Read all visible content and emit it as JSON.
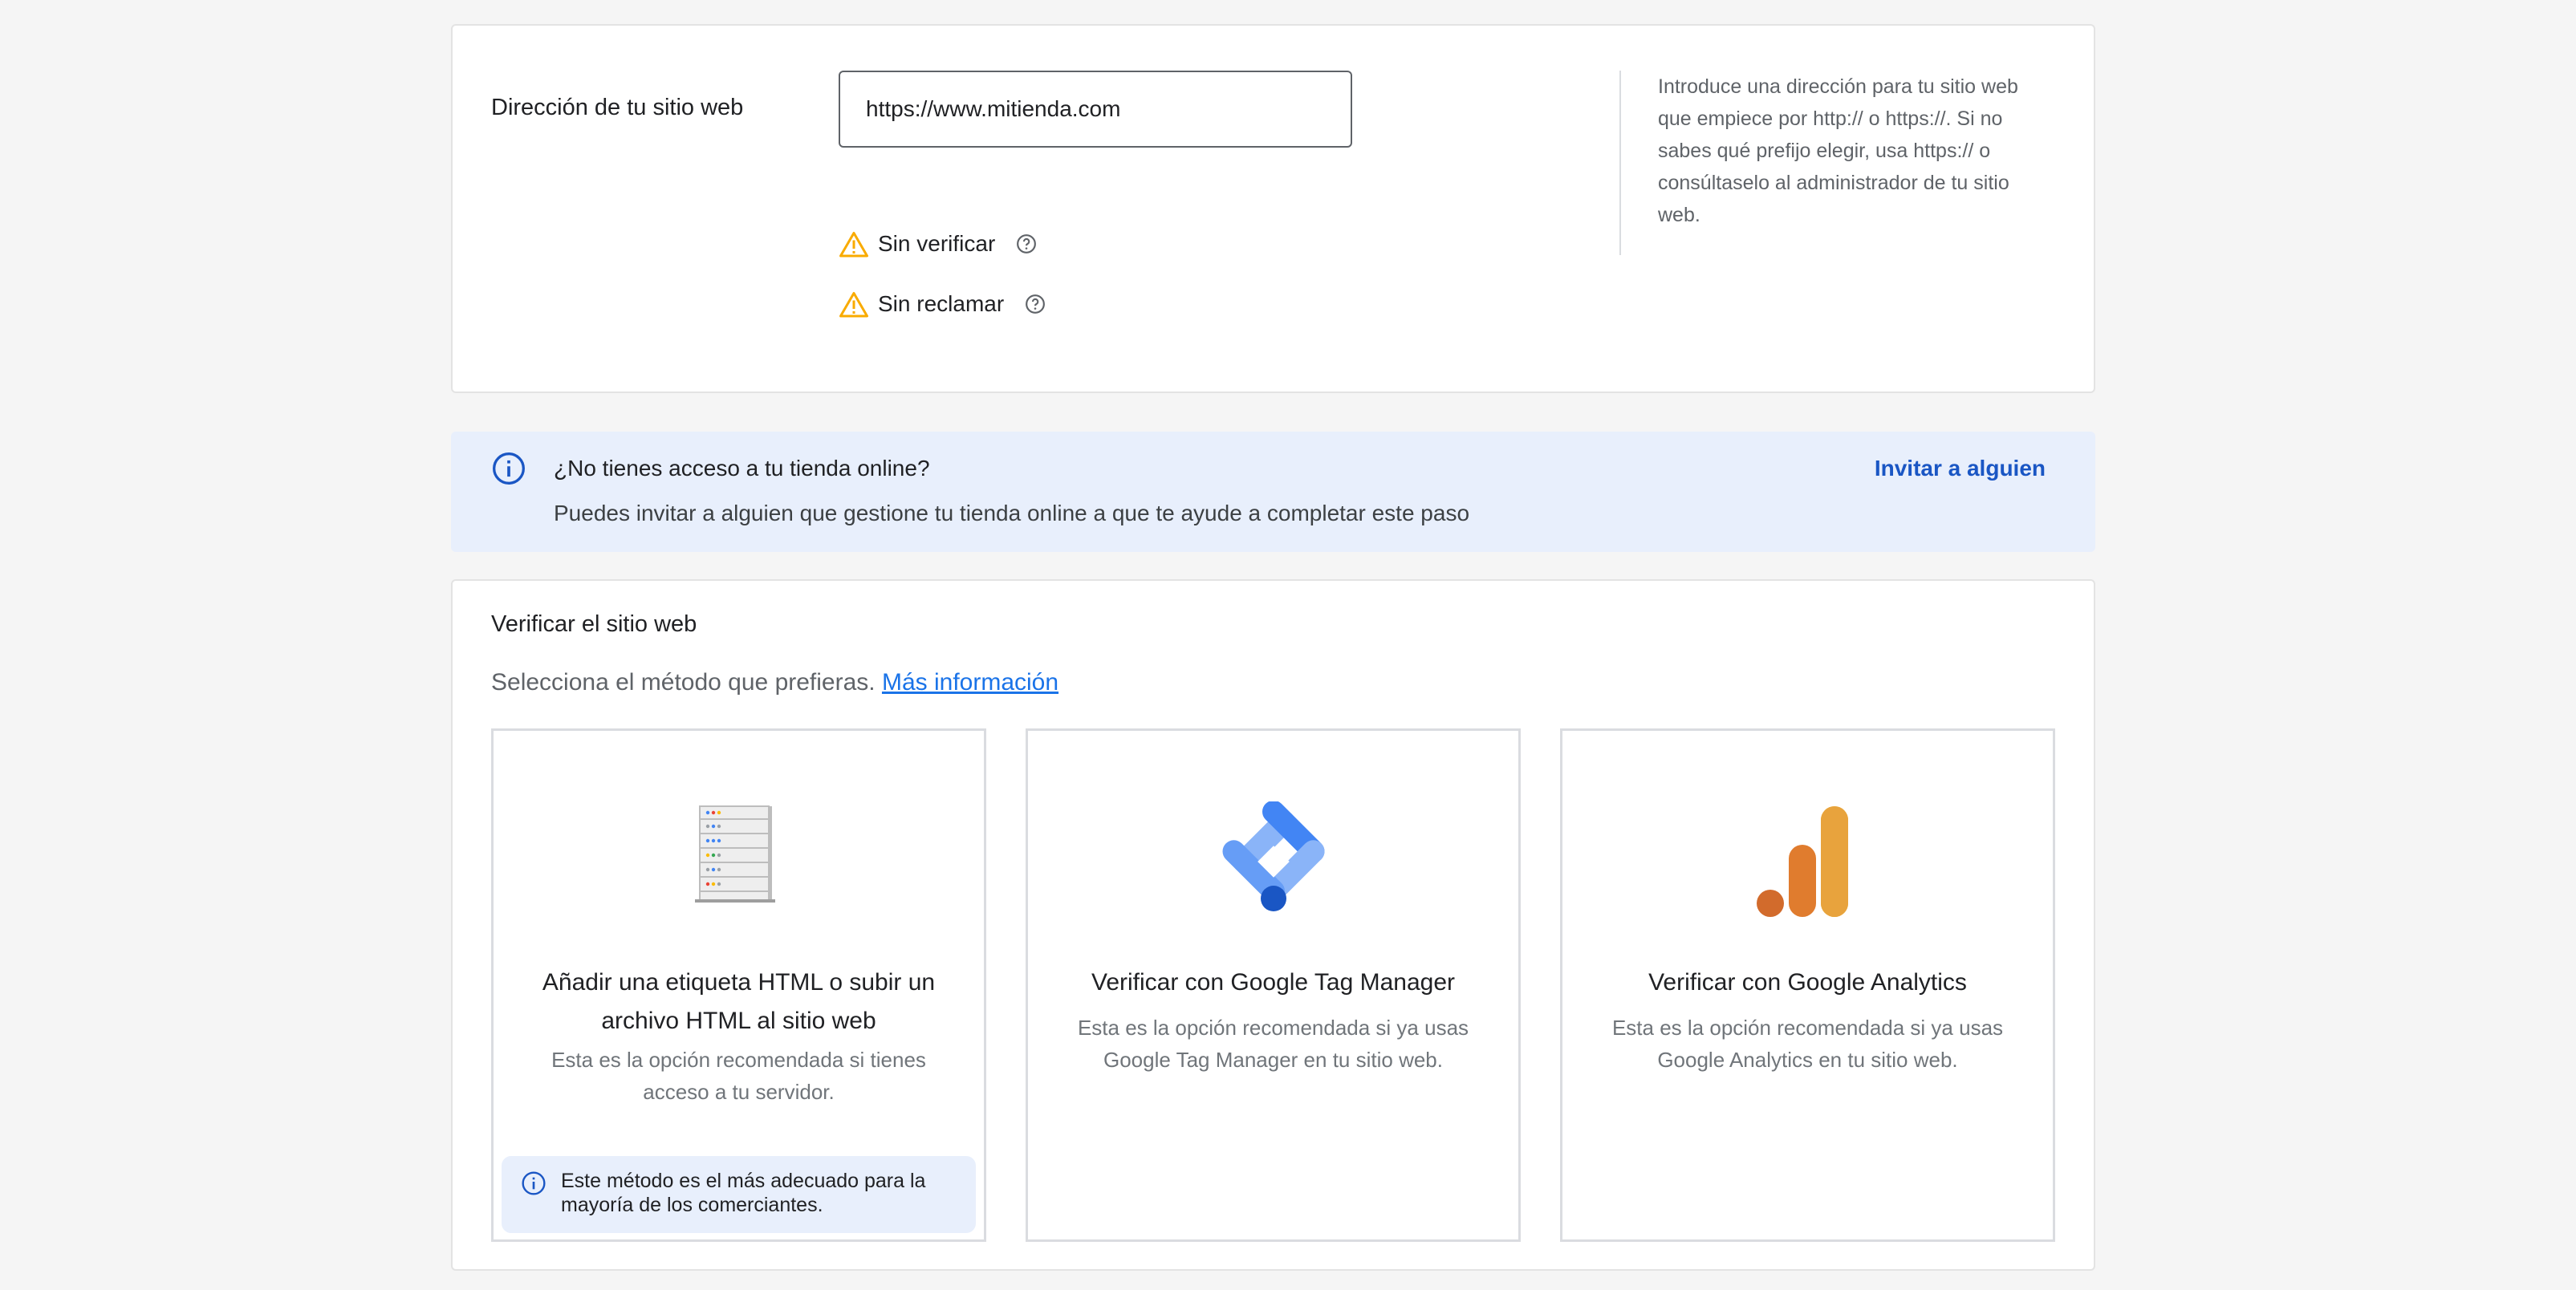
{
  "site": {
    "label": "Dirección de tu sitio web",
    "url_value": "https://www.mitienda.com",
    "status": [
      {
        "label": "Sin verificar",
        "icon": "warning-icon"
      },
      {
        "label": "Sin reclamar",
        "icon": "warning-icon"
      }
    ],
    "help_text": "Introduce una dirección para tu sitio web que empiece por http:// o https://. Si no sabes qué prefijo elegir, usa https:// o consúltaselo al administrador de tu sitio web."
  },
  "banner": {
    "title": "¿No tienes acceso a tu tienda online?",
    "text": "Puedes invitar a alguien que gestione tu tienda online a que te ayude a completar este paso",
    "action": "Invitar a alguien"
  },
  "verify": {
    "title": "Verificar el sitio web",
    "prompt": "Selecciona el método que prefieras.",
    "more_info": "Más información",
    "options": [
      {
        "icon": "server-icon",
        "title": "Añadir una etiqueta HTML o subir un archivo HTML al sitio web",
        "desc": "Esta es la opción recomendada si tienes acceso a tu servidor.",
        "note": "Este método es el más adecuado para la mayoría de los comerciantes."
      },
      {
        "icon": "google-tag-manager-icon",
        "title": "Verificar con Google Tag Manager",
        "desc": "Esta es la opción recomendada si ya usas Google Tag Manager en tu sitio web."
      },
      {
        "icon": "google-analytics-icon",
        "title": "Verificar con Google Analytics",
        "desc": "Esta es la opción recomendada si ya usas Google Analytics en tu sitio web."
      }
    ]
  },
  "colors": {
    "accent_blue": "#1a73e8",
    "link_blue": "#1a56c4",
    "banner_bg": "#e8effc",
    "warning": "#f9ab00"
  }
}
